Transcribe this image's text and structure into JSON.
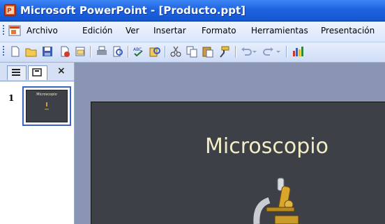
{
  "window": {
    "title": "Microsoft PowerPoint - [Producto.ppt]"
  },
  "menu": [
    "Archivo",
    "Edición",
    "Ver",
    "Insertar",
    "Formato",
    "Herramientas",
    "Presentación"
  ],
  "toolbar": {
    "icons": [
      "new-icon",
      "open-icon",
      "save-icon",
      "permission-icon",
      "email-icon",
      "print-icon",
      "print-preview-icon",
      "spelling-icon",
      "research-icon",
      "cut-icon",
      "copy-icon",
      "paste-icon",
      "format-painter-icon",
      "undo-icon",
      "redo-icon",
      "chart-icon"
    ]
  },
  "pane": {
    "tabs": [
      "outline-tab",
      "slides-tab"
    ],
    "close": "×"
  },
  "slides": [
    {
      "number": "1",
      "title": "Microscopio"
    }
  ],
  "colors": {
    "title_bar": "#1f63df",
    "slide_bg": "#3e4048",
    "slide_title": "#f2edc6",
    "canvas": "#8a95b3"
  }
}
